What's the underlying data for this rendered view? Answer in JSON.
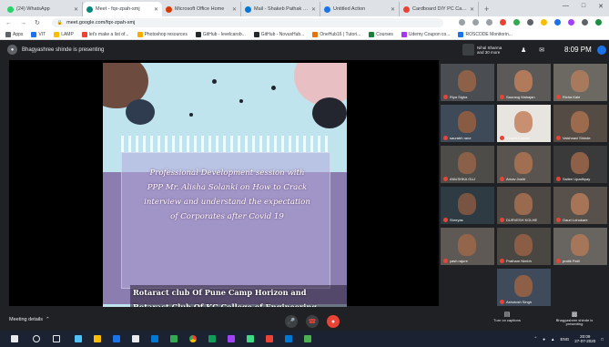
{
  "browser": {
    "tabs": [
      {
        "label": "(24) WhatsApp",
        "color": "#25d366",
        "active": false
      },
      {
        "label": "Meet - fqx-zpah-smj",
        "color": "#00897b",
        "active": true
      },
      {
        "label": "Microsoft Office Home",
        "color": "#d83b01",
        "active": false
      },
      {
        "label": "Mail - Shakeb Pathak - Outl",
        "color": "#0078d4",
        "active": false
      },
      {
        "label": "Untitled Action",
        "color": "#1a73e8",
        "active": false
      },
      {
        "label": "Cardboard DIY PC Case Buil",
        "color": "#ea4335",
        "active": false
      }
    ],
    "url": "meet.google.com/fqx-zpah-smj",
    "bookmarks": [
      {
        "label": "Apps",
        "color": "#5f6368"
      },
      {
        "label": "VIT",
        "color": "#1a73e8"
      },
      {
        "label": "LAMP",
        "color": "#fbbc04"
      },
      {
        "label": "let's make a list of...",
        "color": "#ea4335"
      },
      {
        "label": "Photoshop resources",
        "color": "#f9ab00"
      },
      {
        "label": "GitHub - levelcarob...",
        "color": "#24292e"
      },
      {
        "label": "GitHub - NovusHub...",
        "color": "#24292e"
      },
      {
        "label": "OneHub16 | Tutori...",
        "color": "#e8710a"
      },
      {
        "label": "Courses",
        "color": "#188038"
      },
      {
        "label": "Udemy Coupon co...",
        "color": "#a435f0"
      },
      {
        "label": "ROSCODE Monitorin...",
        "color": "#1a73e8"
      }
    ]
  },
  "meet": {
    "presenting": "Bhagyashree shinde is presenting",
    "pinned_name": "Nihal Sharma",
    "pinned_sub": "and 30 more",
    "time": "8:09 PM",
    "meeting_details": "Meeting details",
    "captions": "Turn on captions",
    "presenting_label": "Bhagyashree shinde is presenting"
  },
  "slide": {
    "lines": [
      "Professional Development session with",
      "PPP Mr. Alisha Solanki on How to Crack",
      "interview and understand the expectation",
      "of Corporates after Covid 19"
    ],
    "foot1": "Rotaract club Of Pune Camp Horizon and",
    "foot2": "Rotaract Club Of KC College of Engineering"
  },
  "participants": [
    {
      "name": "Riya Sigha",
      "bg": "#4a4d52",
      "skin": "#8d6148"
    },
    {
      "name": "Saurang Mahajan",
      "bg": "#5b5a58",
      "skin": "#b07a5b"
    },
    {
      "name": "Richa Kale",
      "bg": "#6c6963",
      "skin": "#a77a5e"
    },
    {
      "name": "saurabh rane",
      "bg": "#3e4a57",
      "skin": "#8a5b43"
    },
    {
      "name": "Vinanti Kudale",
      "bg": "#e8e4df",
      "skin": "#c88f70"
    },
    {
      "name": "Vaishnavi Shinde",
      "bg": "#554b45",
      "skin": "#9c6b4d"
    },
    {
      "name": "ANUSHKA GUJ",
      "bg": "#4e4c49",
      "skin": "#8a6048"
    },
    {
      "name": "Arnav Joshi",
      "bg": "#5a5450",
      "skin": "#a06f52"
    },
    {
      "name": "Sailee Upadhyay",
      "bg": "#3b3a3a",
      "skin": "#8e6047"
    },
    {
      "name": "Shreyas",
      "bg": "#2f3b43",
      "skin": "#7a5442"
    },
    {
      "name": "DURVESH KOLHE",
      "bg": "#4d4843",
      "skin": "#9a6a4e"
    },
    {
      "name": "Gauri Lohokare",
      "bg": "#57504b",
      "skin": "#a87458"
    },
    {
      "name": "yash rajure",
      "bg": "#5e5955",
      "skin": "#93654a"
    },
    {
      "name": "Pratham Nimbh",
      "bg": "#4a4642",
      "skin": "#8b5d44"
    },
    {
      "name": "pratik Patil",
      "bg": "#686460",
      "skin": "#a57659"
    },
    {
      "name": "Ashutosh Singh",
      "bg": "#3f4b5a",
      "skin": "#8c5f46"
    }
  ],
  "taskbar": {
    "lang": "ENG",
    "time": "20:09",
    "date": "27-07-2020"
  }
}
